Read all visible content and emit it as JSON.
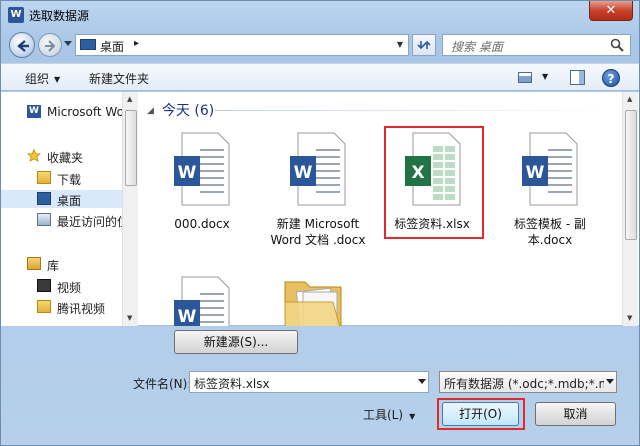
{
  "window": {
    "title": "选取数据源",
    "close": "✕",
    "app_icon_letter": "W"
  },
  "nav": {
    "address": "桌面",
    "address_chevron": "▸",
    "search_placeholder": "搜索 桌面"
  },
  "toolbar": {
    "organize": "组织",
    "new_folder": "新建文件夹",
    "help": "?"
  },
  "sidebar": {
    "items": [
      {
        "label": "Microsoft Wo",
        "icon": "word-icon"
      },
      {
        "label": "收藏夹",
        "icon": "star-icon"
      },
      {
        "label": "下载",
        "icon": "download-folder-icon"
      },
      {
        "label": "桌面",
        "icon": "desktop-icon",
        "selected": true
      },
      {
        "label": "最近访问的位",
        "icon": "recent-places-icon"
      },
      {
        "label": "库",
        "icon": "library-icon"
      },
      {
        "label": "视频",
        "icon": "video-library-icon"
      },
      {
        "label": "腾讯视频",
        "icon": "folder-icon"
      }
    ]
  },
  "files": {
    "group_label": "今天 (6)",
    "items": [
      {
        "name": "000.docx",
        "type": "word"
      },
      {
        "name": "新建 Microsoft Word 文档 .docx",
        "type": "word"
      },
      {
        "name": "标签资料.xlsx",
        "type": "excel",
        "selected": true
      },
      {
        "name": "标签模板 - 副本.docx",
        "type": "word"
      },
      {
        "name": "",
        "type": "word"
      },
      {
        "name": "",
        "type": "folder"
      }
    ]
  },
  "footer": {
    "new_source_button": "新建源(S)...",
    "filename_label": "文件名(N):",
    "filename_value": "标签资料.xlsx",
    "filetype_value": "所有数据源 (*.odc;*.mdb;*.md",
    "tools_label": "工具(L)",
    "open_button": "打开(O)",
    "cancel_button": "取消"
  },
  "colors": {
    "highlight": "#e32a2a",
    "word": "#2b579a",
    "excel": "#217346"
  }
}
